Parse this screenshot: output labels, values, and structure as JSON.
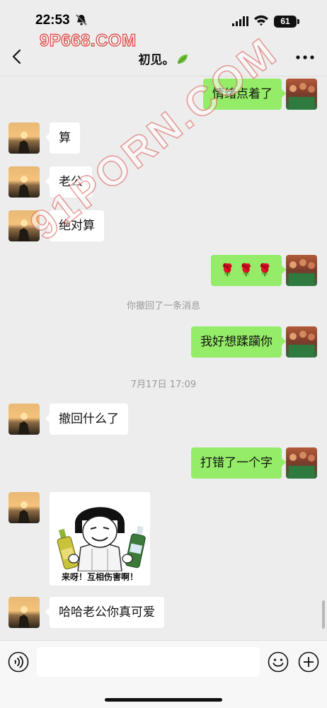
{
  "status_bar": {
    "time": "22:53",
    "battery": "61"
  },
  "watermark": {
    "top": "9P668.COM",
    "diagonal": "91PORN.COM"
  },
  "header": {
    "title": "初见。"
  },
  "messages": [
    {
      "side": "out",
      "text": "情绪点着了"
    },
    {
      "side": "in",
      "text": "算"
    },
    {
      "side": "in",
      "text": "老公"
    },
    {
      "side": "in",
      "text": "绝对算"
    },
    {
      "side": "out",
      "text": "🌹 🌹 🌹"
    },
    {
      "side": "system",
      "text": "你撤回了一条消息"
    },
    {
      "side": "out",
      "text": "我好想蹂躏你"
    },
    {
      "side": "system",
      "text": "7月17日 17:09"
    },
    {
      "side": "in",
      "text": "撤回什么了"
    },
    {
      "side": "out",
      "text": "打错了一个字"
    },
    {
      "side": "in",
      "type": "sticker",
      "caption": "来呀！互相伤害啊！"
    },
    {
      "side": "in",
      "text": "哈哈老公你真可爱"
    }
  ],
  "input": {
    "value": "",
    "placeholder": ""
  },
  "colors": {
    "background": "#ededed",
    "outgoing_bubble": "#95ec69",
    "incoming_bubble": "#ffffff"
  }
}
